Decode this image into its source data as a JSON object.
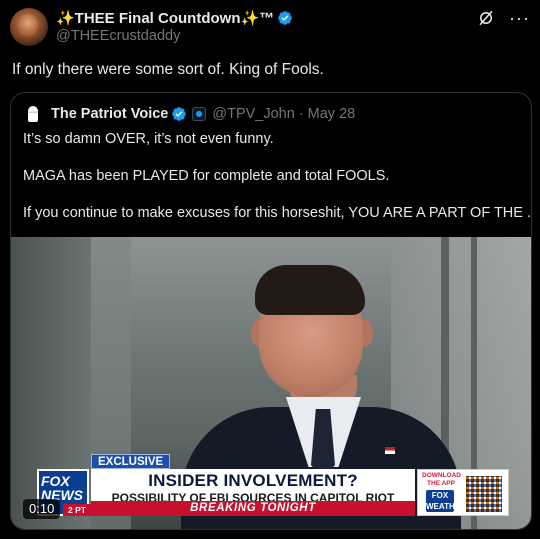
{
  "tweet": {
    "display_name": "✨THEE Final Countdown✨™",
    "handle": "@THEEcrustdaddy",
    "text": "If only there were some sort of. King of Fools.",
    "more_glyph": "···"
  },
  "quoted_tweet": {
    "display_name": "The Patriot Voice",
    "handle": "@TPV_John",
    "separator": "·",
    "date": "May 28",
    "lines": [
      "It’s so damn OVER, it’s not even funny.",
      "MAGA has been PLAYED for complete and total FOOLS.",
      "If you continue to make excuses for this horseshit, YOU ARE A PART OF THE ..."
    ]
  },
  "video": {
    "timestamp": "0:10",
    "chyron": {
      "tag": "EXCLUSIVE",
      "headline": "INSIDER INVOLVEMENT?",
      "subhead": "POSSIBILITY OF FBI SOURCES IN CAPITOL RIOT",
      "ticker": "BREAKING TONIGHT",
      "network_line1": "FOX",
      "network_line2": "NEWS",
      "time_badge": "2 PT",
      "app_promo": "DOWNLOAD THE APP",
      "app_logo": "FOX WEATHER"
    }
  },
  "colors": {
    "verified": "#1d9bf0",
    "background": "#000000",
    "border": "#2f3336",
    "muted_text": "#71767b"
  }
}
